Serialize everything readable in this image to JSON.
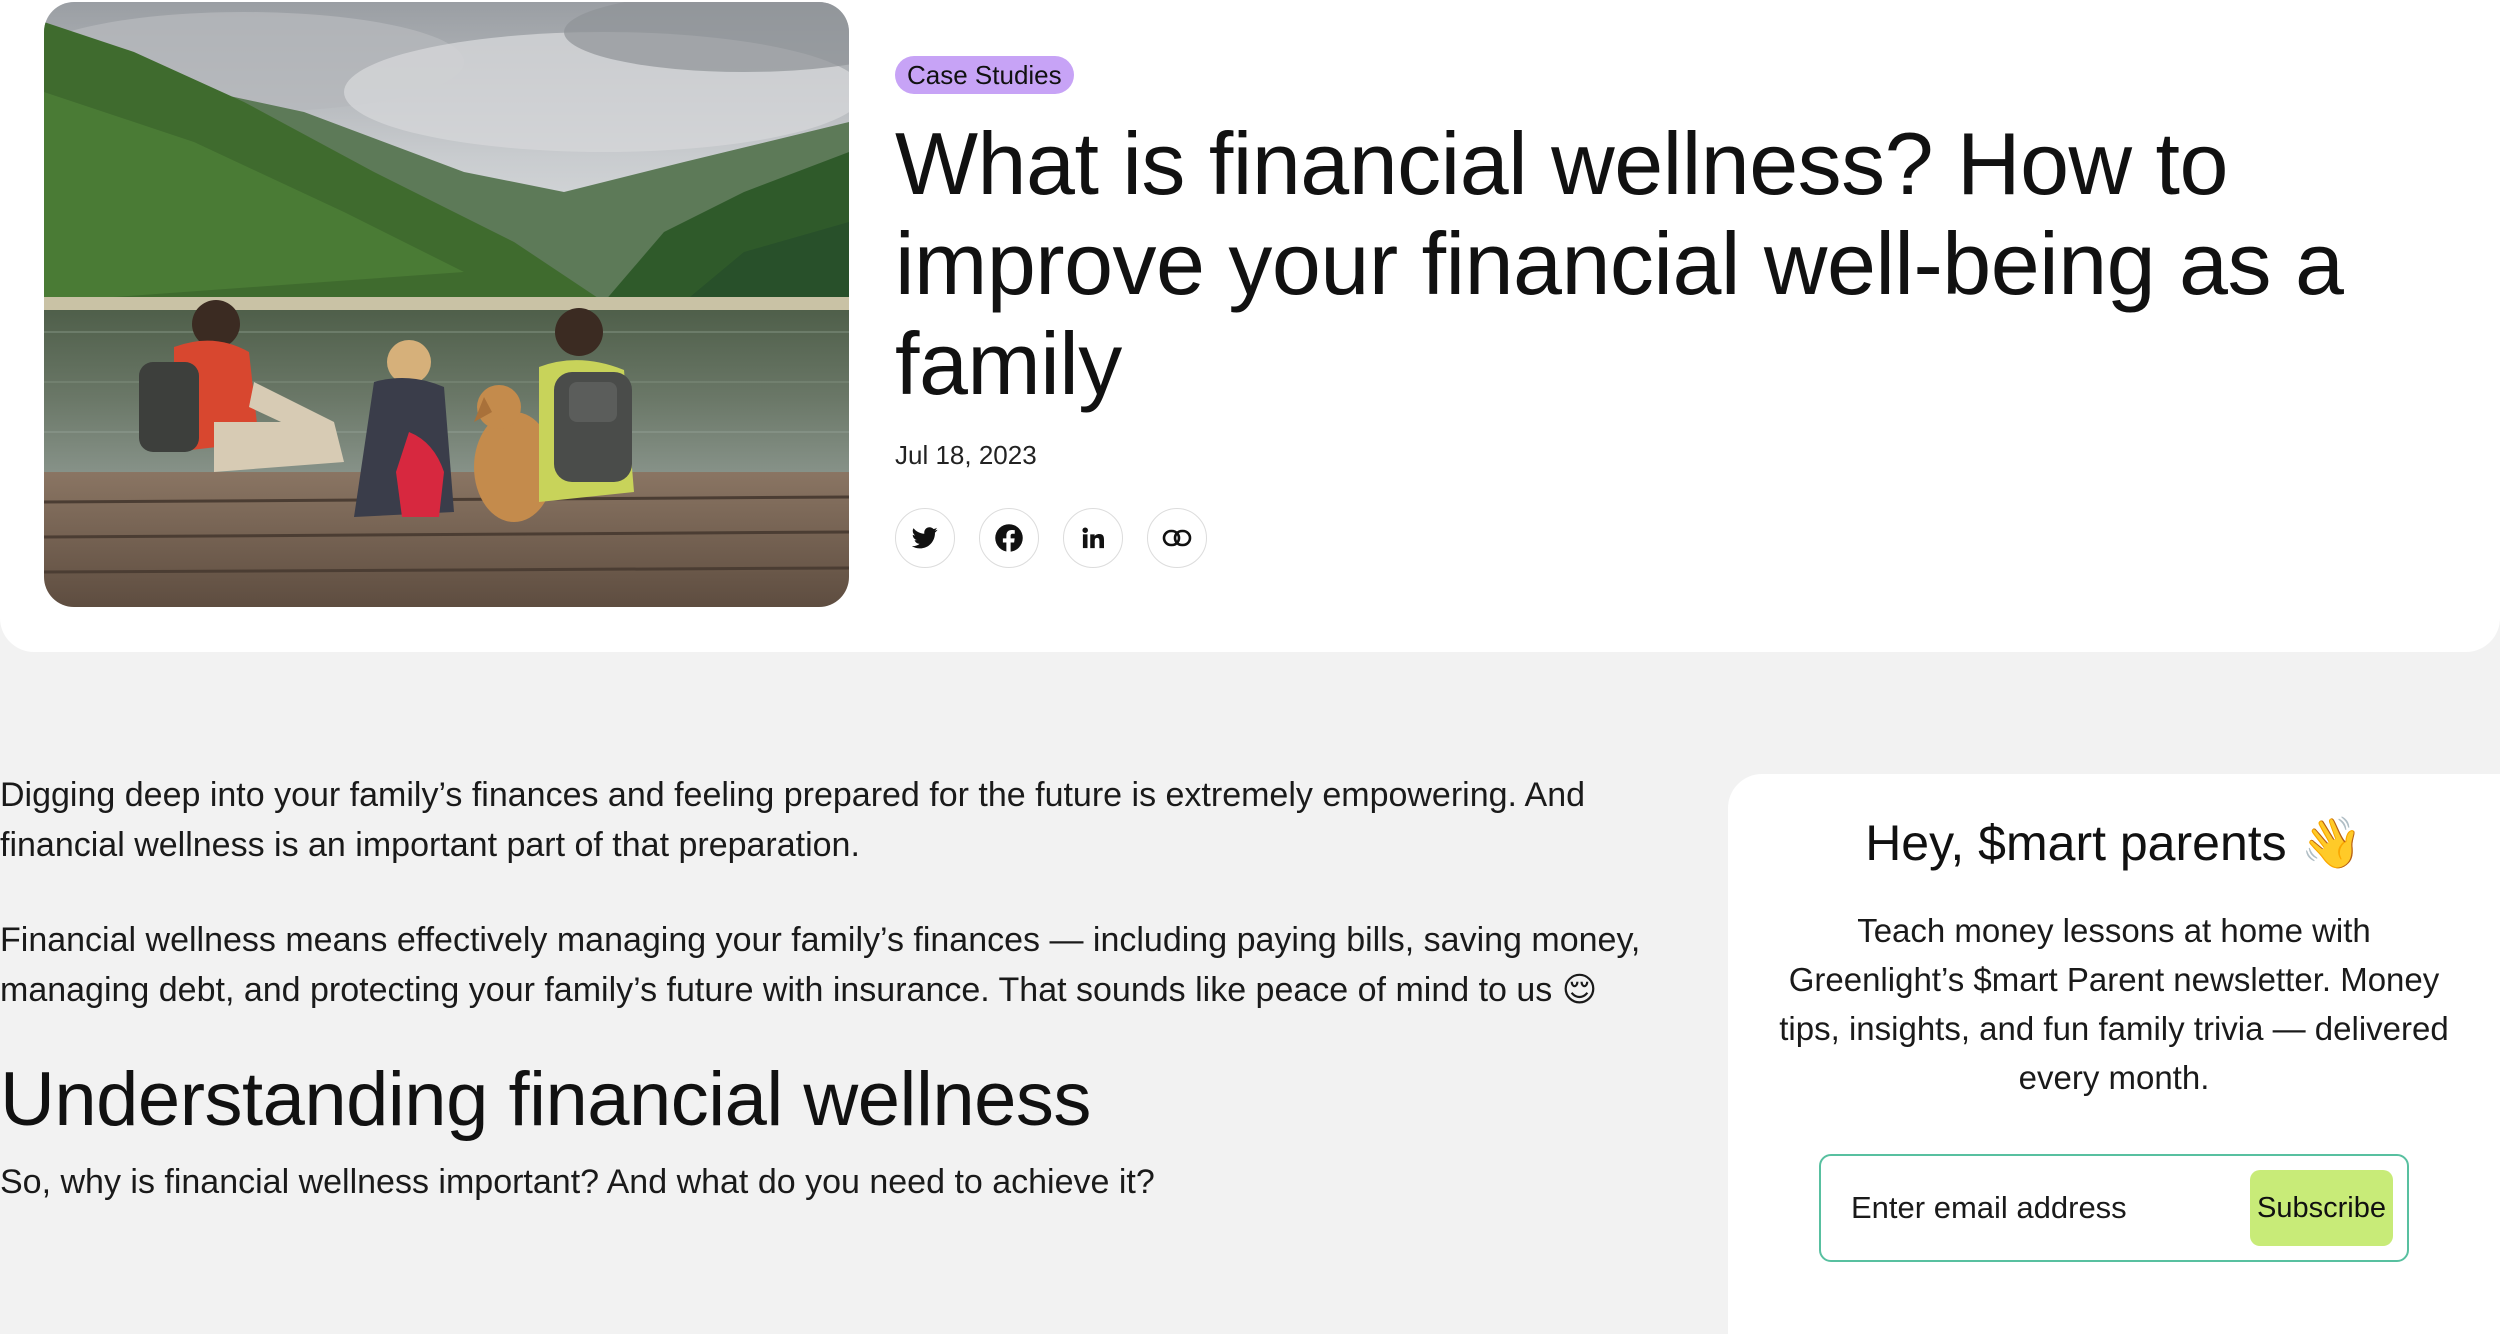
{
  "hero": {
    "tag": "Case Studies",
    "title": "What is financial wellness? How to improve your financial well-being as a family",
    "date": "Jul 18, 2023",
    "share": [
      {
        "icon": "twitter-icon"
      },
      {
        "icon": "facebook-icon"
      },
      {
        "icon": "linkedin-icon"
      },
      {
        "icon": "link-icon"
      }
    ],
    "image": {
      "alt": "Family with a dog sitting on a wooden dock by a mountain lake"
    }
  },
  "article": {
    "paragraphs": [
      "Digging deep into your family’s finances and feeling prepared for the future is extremely empowering. And financial wellness is an important part of that preparation.",
      "Financial wellness means effectively managing your family’s finances — including paying bills, saving money, managing debt, and protecting your family’s future with insurance. That sounds like peace of mind to us 😌"
    ],
    "section_heading": "Understanding financial wellness",
    "section_paragraph": "So, why is financial wellness important? And what do you need to achieve it?"
  },
  "newsletter": {
    "heading": "Hey, $mart parents 👋",
    "body": "Teach money lessons at home with Greenlight’s $mart Parent newsletter. Money tips, insights, and fun family trivia — delivered every month.",
    "email_placeholder": "Enter email address",
    "subscribe_label": "Subscribe"
  },
  "colors": {
    "page_background": "#f2f2f2",
    "card_background": "#ffffff",
    "tag_background": "#c7a3f6",
    "subscribe_button": "#c8eb78",
    "form_border": "#58c0a0"
  }
}
